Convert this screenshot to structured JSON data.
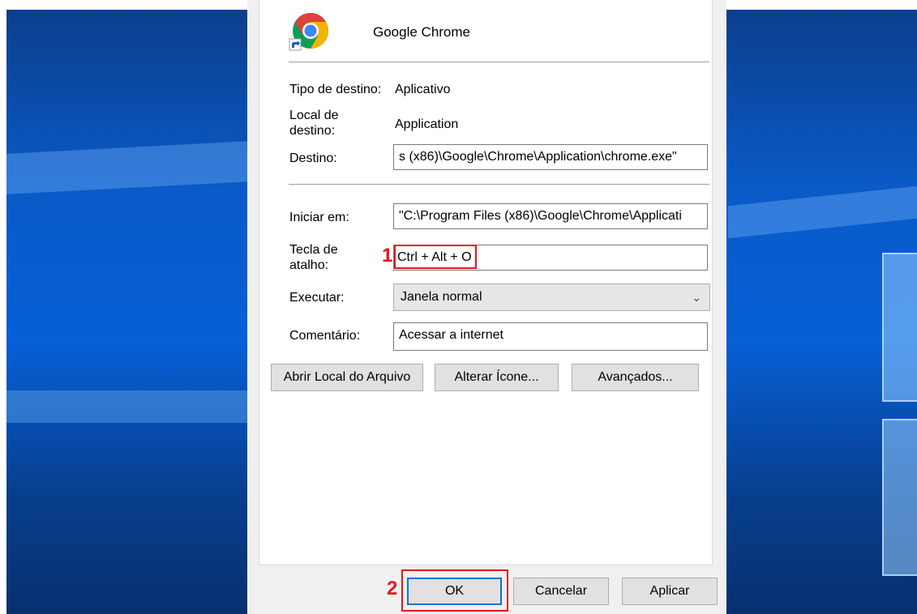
{
  "app": {
    "name": "Google Chrome",
    "icon": "chrome-shortcut-icon"
  },
  "target_type": {
    "label": "Tipo de destino:",
    "value": "Aplicativo"
  },
  "target_location": {
    "label_line1": "Local de",
    "label_line2": "destino:",
    "value": "Application"
  },
  "target": {
    "label": "Destino:",
    "value": "s (x86)\\Google\\Chrome\\Application\\chrome.exe\""
  },
  "start_in": {
    "label": "Iniciar em:",
    "value": "\"C:\\Program Files (x86)\\Google\\Chrome\\Applicati"
  },
  "shortcut_key": {
    "label_line1": "Tecla de",
    "label_line2": "atalho:",
    "value": "Ctrl + Alt + O"
  },
  "run": {
    "label": "Executar:",
    "selected": "Janela normal"
  },
  "comment": {
    "label": "Comentário:",
    "value": "Acessar a internet"
  },
  "action_buttons": {
    "open_location": "Abrir Local do Arquivo",
    "change_icon": "Alterar Ícone...",
    "advanced": "Avançados..."
  },
  "footer_buttons": {
    "ok": "OK",
    "cancel": "Cancelar",
    "apply": "Aplicar"
  },
  "markers": {
    "step1": "1",
    "step2": "2"
  },
  "colors": {
    "highlight": "#e8141b",
    "focus": "#0078d7",
    "chrome_red": "#db4437",
    "chrome_yellow": "#f4b400",
    "chrome_green": "#0f9d58",
    "chrome_blue": "#4285f4"
  }
}
